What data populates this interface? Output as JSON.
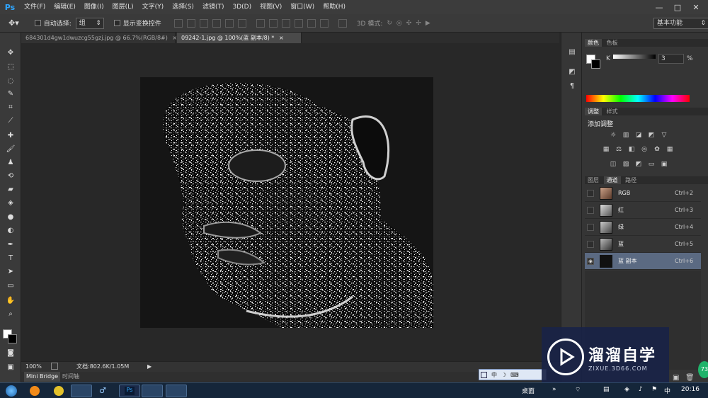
{
  "menubar": {
    "app_logo": "Ps",
    "items": [
      "文件(F)",
      "编辑(E)",
      "图像(I)",
      "图层(L)",
      "文字(Y)",
      "选择(S)",
      "滤镜(T)",
      "3D(D)",
      "视图(V)",
      "窗口(W)",
      "帮助(H)"
    ],
    "window_controls": [
      "—",
      "□",
      "✕"
    ]
  },
  "options": {
    "auto_select_label": "自动选择:",
    "auto_select_value": "组",
    "show_transform_label": "显示变换控件",
    "mode3d_label": "3D 模式:",
    "workspace_value": "基本功能"
  },
  "tabs": [
    {
      "label": "684301d4gw1dwuzcg55gzj.jpg @ 66.7%(RGB/8#)",
      "close": "×"
    },
    {
      "label": "09242-1.jpg @ 100%(蓝 副本/8) *",
      "close": "×"
    }
  ],
  "status": {
    "zoom": "100%",
    "doc_info": "文档:802.6K/1.05M",
    "arrow": "▶"
  },
  "bottom_tabs": [
    "Mini Bridge",
    "时间轴"
  ],
  "color_panel": {
    "tabs": [
      "颜色",
      "色板"
    ],
    "channel_label": "K",
    "value": "3",
    "unit": "%"
  },
  "adjust_panel": {
    "tabs": [
      "调整",
      "样式"
    ],
    "heading": "添加调整"
  },
  "channels_panel": {
    "tabs": [
      "图层",
      "通道",
      "路径"
    ],
    "rows": [
      {
        "name": "RGB",
        "shortcut": "Ctrl+2"
      },
      {
        "name": "红",
        "shortcut": "Ctrl+3"
      },
      {
        "name": "绿",
        "shortcut": "Ctrl+4"
      },
      {
        "name": "蓝",
        "shortcut": "Ctrl+5"
      },
      {
        "name": "蓝 副本",
        "shortcut": "Ctrl+6"
      }
    ]
  },
  "watermark": {
    "title": "溜溜自学",
    "subtitle": "ZIXUE.3D66.COM"
  },
  "ime": {
    "items": [
      "中",
      "☽",
      "⌨"
    ]
  },
  "taskbar": {
    "desktop_label": "桌面",
    "time": "20:16",
    "badge": "73"
  },
  "colors": {
    "accent": "#2fa6ff",
    "selected_row": "#5b6a82",
    "watermark_bg": "#19234a"
  }
}
